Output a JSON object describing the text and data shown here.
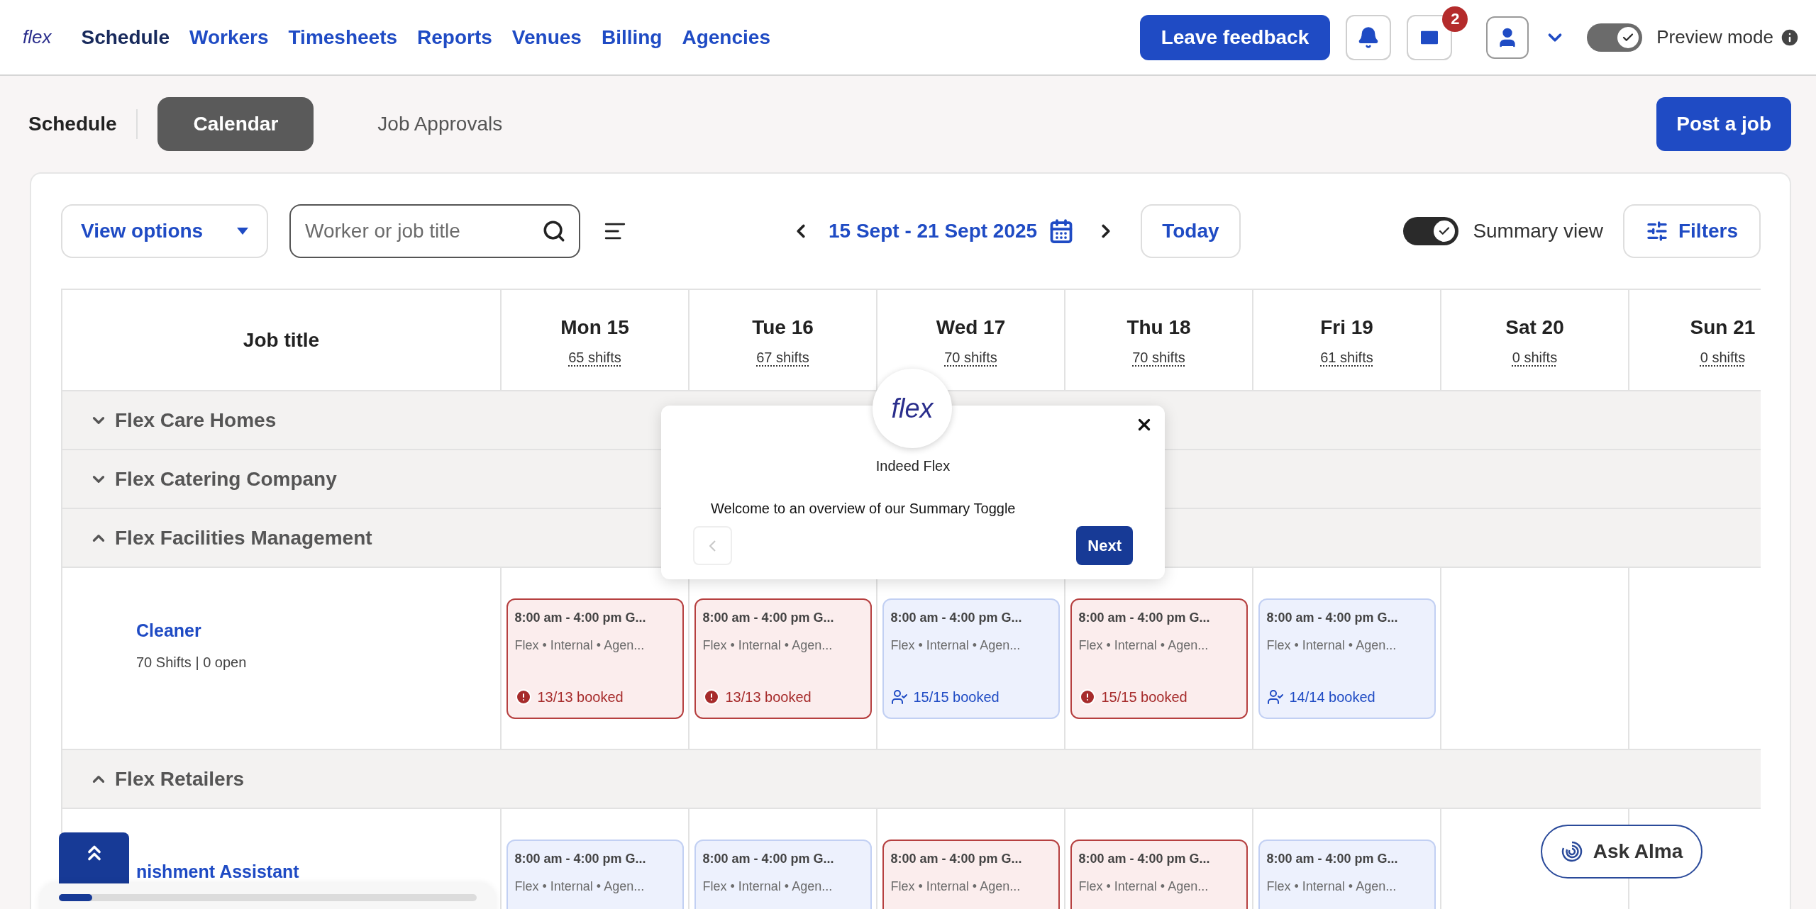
{
  "nav": {
    "logo": "flex",
    "items": [
      {
        "label": "Schedule",
        "selected": true
      },
      {
        "label": "Workers",
        "selected": false
      },
      {
        "label": "Timesheets",
        "selected": false
      },
      {
        "label": "Reports",
        "selected": false
      },
      {
        "label": "Venues",
        "selected": false
      },
      {
        "label": "Billing",
        "selected": false
      },
      {
        "label": "Agencies",
        "selected": false
      }
    ],
    "feedback_button": "Leave feedback",
    "mail_badge": "2",
    "preview_mode": {
      "label": "Preview mode",
      "on": true
    }
  },
  "subheader": {
    "title": "Schedule",
    "tabs": [
      {
        "label": "Calendar",
        "selected": true
      },
      {
        "label": "Job Approvals",
        "selected": false
      }
    ],
    "post_button": "Post a job"
  },
  "toolbar": {
    "view_options": "View options",
    "search": {
      "placeholder": "Worker or job title"
    },
    "date_range": "15 Sept - 21 Sept 2025",
    "today_button": "Today",
    "summary_view": {
      "label": "Summary view",
      "on": true
    },
    "filters_button": "Filters"
  },
  "table": {
    "first_column": "Job title",
    "days": [
      {
        "label": "Mon 15",
        "shifts": "65 shifts"
      },
      {
        "label": "Tue 16",
        "shifts": "67 shifts"
      },
      {
        "label": "Wed 17",
        "shifts": "70 shifts"
      },
      {
        "label": "Thu 18",
        "shifts": "70 shifts"
      },
      {
        "label": "Fri 19",
        "shifts": "61 shifts"
      },
      {
        "label": "Sat 20",
        "shifts": "0 shifts"
      },
      {
        "label": "Sun 21",
        "shifts": "0 shifts"
      }
    ],
    "groups": [
      {
        "name": "Flex Care Homes",
        "expanded": false
      },
      {
        "name": "Flex Catering Company",
        "expanded": false
      },
      {
        "name": "Flex Facilities Management",
        "expanded": true,
        "jobs": [
          {
            "title": "Cleaner",
            "summary": "70 Shifts | 0 open",
            "cells": [
              {
                "kind": "alert",
                "time": "8:00 am - 4:00 pm G...",
                "details": "Flex • Internal • Agen...",
                "booked": "13/13 booked"
              },
              {
                "kind": "alert",
                "time": "8:00 am - 4:00 pm G...",
                "details": "Flex • Internal • Agen...",
                "booked": "13/13 booked"
              },
              {
                "kind": "booked",
                "time": "8:00 am - 4:00 pm G...",
                "details": "Flex • Internal • Agen...",
                "booked": "15/15 booked"
              },
              {
                "kind": "alert",
                "time": "8:00 am - 4:00 pm G...",
                "details": "Flex • Internal • Agen...",
                "booked": "15/15 booked"
              },
              {
                "kind": "booked",
                "time": "8:00 am - 4:00 pm G...",
                "details": "Flex • Internal • Agen...",
                "booked": "14/14 booked"
              },
              {
                "kind": "empty"
              },
              {
                "kind": "empty"
              }
            ]
          }
        ]
      },
      {
        "name": "Flex Retailers",
        "expanded": true,
        "jobs": [
          {
            "title": "nishment Assistant",
            "cells": [
              {
                "kind": "booked",
                "time": "8:00 am - 4:00 pm G...",
                "details": "Flex • Internal • Agen..."
              },
              {
                "kind": "booked",
                "time": "8:00 am - 4:00 pm G...",
                "details": "Flex • Internal • Agen..."
              },
              {
                "kind": "alert",
                "time": "8:00 am - 4:00 pm G...",
                "details": "Flex • Internal • Agen..."
              },
              {
                "kind": "alert",
                "time": "8:00 am - 4:00 pm G...",
                "details": "Flex • Internal • Agen..."
              },
              {
                "kind": "booked",
                "time": "8:00 am - 4:00 pm G...",
                "details": "Flex • Internal • Agen..."
              },
              {
                "kind": "empty"
              },
              {
                "kind": "empty"
              }
            ]
          }
        ]
      }
    ]
  },
  "popup": {
    "logo": "flex",
    "brand": "Indeed Flex",
    "message": "Welcome to an overview of our Summary Toggle",
    "previous_disabled": true,
    "next_button": "Next"
  },
  "scroll_progress": {
    "level": 0.08
  },
  "ask_button": "Ask Alma"
}
